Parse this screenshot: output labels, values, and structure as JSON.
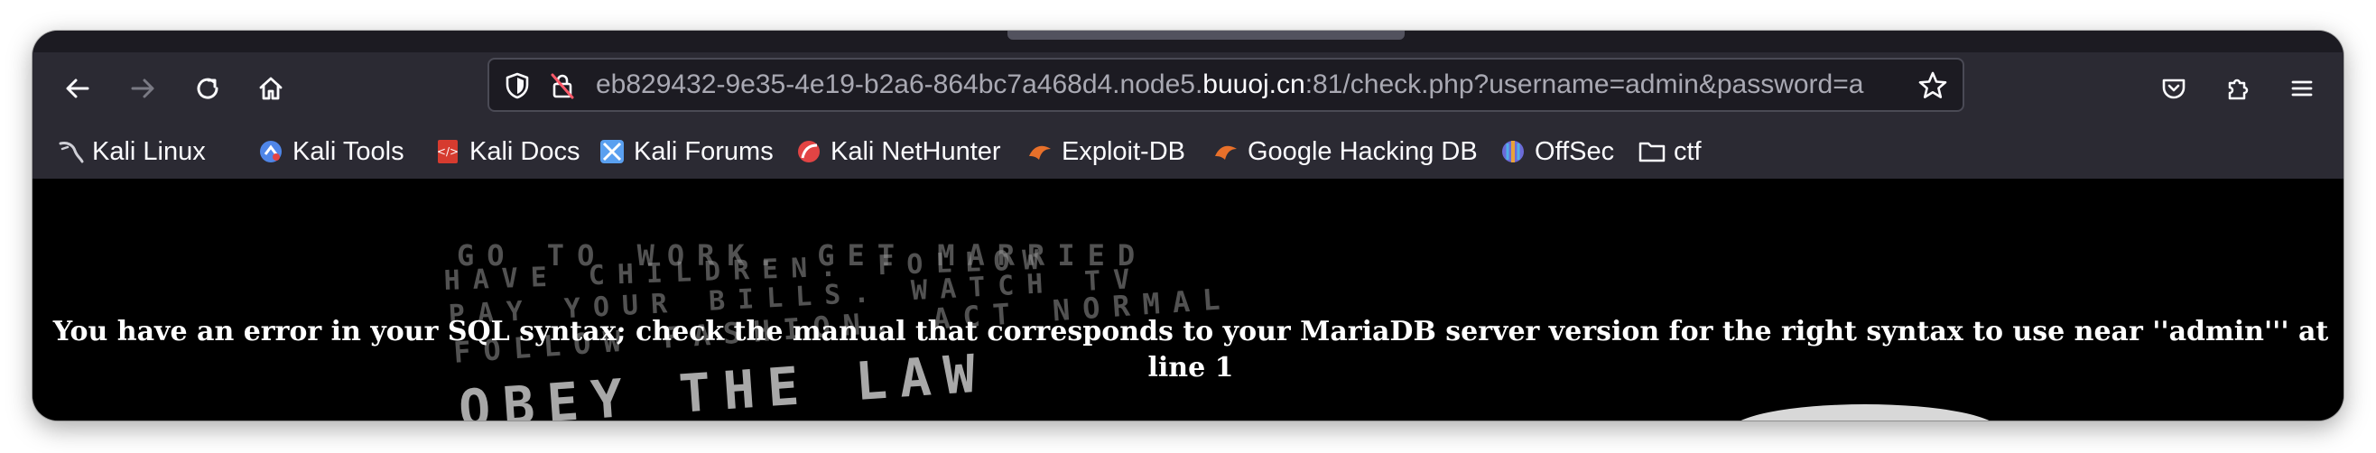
{
  "browser": {
    "url": {
      "prefix": "eb829432-9e35-4e19-b2a6-864bc7a468d4.node5.",
      "host": "buuoj.cn",
      "suffix": ":81/check.php?username=admin&password=a"
    },
    "nav": {
      "back_icon": "arrow-left-icon",
      "forward_icon": "arrow-right-icon",
      "reload_icon": "reload-icon",
      "home_icon": "home-icon"
    },
    "toolbar_icons": [
      "pocket-icon",
      "extensions-icon",
      "menu-icon"
    ]
  },
  "bookmarks": [
    {
      "label": "Kali Linux",
      "icon": "kali-dragon-icon",
      "color": "#c9c9d0"
    },
    {
      "label": "Kali Tools",
      "icon": "kali-tools-icon",
      "color": "#4f86e8"
    },
    {
      "label": "Kali Docs",
      "icon": "kali-docs-icon",
      "color": "#d63b2f"
    },
    {
      "label": "Kali Forums",
      "icon": "kali-forums-icon",
      "color": "#5aa0f0"
    },
    {
      "label": "Kali NetHunter",
      "icon": "nethunter-icon",
      "color": "#e24444"
    },
    {
      "label": "Exploit-DB",
      "icon": "exploit-db-icon",
      "color": "#e8702a"
    },
    {
      "label": "Google Hacking DB",
      "icon": "ghdb-icon",
      "color": "#e8702a"
    },
    {
      "label": "OffSec",
      "icon": "offsec-icon",
      "color": "#6b6bd8"
    },
    {
      "label": "ctf",
      "icon": "folder-icon",
      "color": "#fbfbfe"
    }
  ],
  "page": {
    "error_message": "You have an error in your SQL syntax; check the manual that corresponds to your MariaDB server version for the right syntax to use near ''admin''' at line 1",
    "background_text": [
      "GO TO WORK. GET MARRIED",
      "HAVE CHILDREN. FOLLOW",
      "PAY YOUR BILLS. WATCH TV",
      "FOLLOW FASHION. ACT NORMAL",
      "OBEY THE LAW"
    ]
  }
}
